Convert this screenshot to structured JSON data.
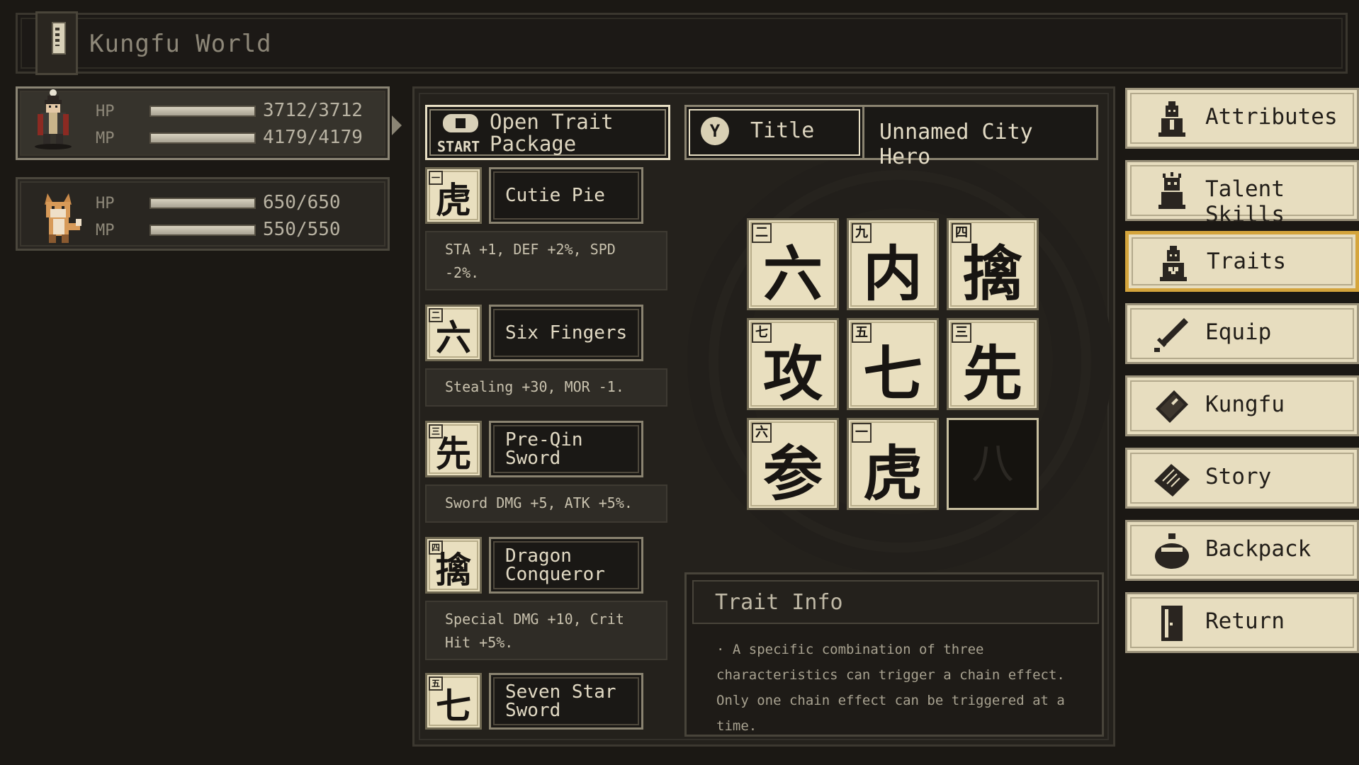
{
  "header": {
    "title": "Kungfu World"
  },
  "party": [
    {
      "hp_label": "HP",
      "hp_value": "3712/3712",
      "hp_ratio": 1.0,
      "mp_label": "MP",
      "mp_value": "4179/4179",
      "mp_ratio": 1.0,
      "active": true
    },
    {
      "hp_label": "HP",
      "hp_value": "650/650",
      "hp_ratio": 1.0,
      "mp_label": "MP",
      "mp_value": "550/550",
      "mp_ratio": 1.0,
      "active": false
    }
  ],
  "open_trait": {
    "button_glyph": "START",
    "label": "Open Trait Package"
  },
  "title_box": {
    "button_glyph": "Y",
    "label": "Title",
    "value": "Unnamed City Hero"
  },
  "traits": [
    {
      "num": "一",
      "glyph": "虎",
      "name": "Cutie Pie",
      "desc": "STA +1, DEF +2%, SPD -2%."
    },
    {
      "num": "二",
      "glyph": "六",
      "name": "Six Fingers",
      "desc": "Stealing +30, MOR -1."
    },
    {
      "num": "三",
      "glyph": "先",
      "name": "Pre-Qin Sword",
      "desc": "Sword DMG +5, ATK +5%."
    },
    {
      "num": "四",
      "glyph": "擒",
      "name": "Dragon Conqueror",
      "desc": "Special DMG +10, Crit Hit +5%."
    },
    {
      "num": "五",
      "glyph": "七",
      "name": "Seven Star Sword"
    }
  ],
  "grid": [
    {
      "num": "二",
      "glyph": "六"
    },
    {
      "num": "九",
      "glyph": "内"
    },
    {
      "num": "四",
      "glyph": "擒"
    },
    {
      "num": "七",
      "glyph": "攻"
    },
    {
      "num": "五",
      "glyph": "七"
    },
    {
      "num": "三",
      "glyph": "先"
    },
    {
      "num": "六",
      "glyph": "参"
    },
    {
      "num": "一",
      "glyph": "虎"
    },
    {
      "glyph": "八",
      "empty": true
    }
  ],
  "trait_info": {
    "title": "Trait Info",
    "text": "· A specific combination of three characteristics can trigger a chain effect. Only one chain effect can be triggered at a time."
  },
  "menu": [
    {
      "label": "Attributes",
      "icon": "character-icon"
    },
    {
      "label": "Talent Skills",
      "icon": "talent-icon"
    },
    {
      "label": "Traits",
      "icon": "traits-icon",
      "active": true
    },
    {
      "label": "Equip",
      "icon": "sword-icon"
    },
    {
      "label": "Kungfu",
      "icon": "book-icon"
    },
    {
      "label": "Story",
      "icon": "scroll-icon"
    },
    {
      "label": "Backpack",
      "icon": "bag-icon"
    },
    {
      "label": "Return",
      "icon": "door-icon"
    }
  ],
  "colors": {
    "accent": "#d4a43c",
    "parchment": "#e9dfbf",
    "background": "#1b1814"
  }
}
